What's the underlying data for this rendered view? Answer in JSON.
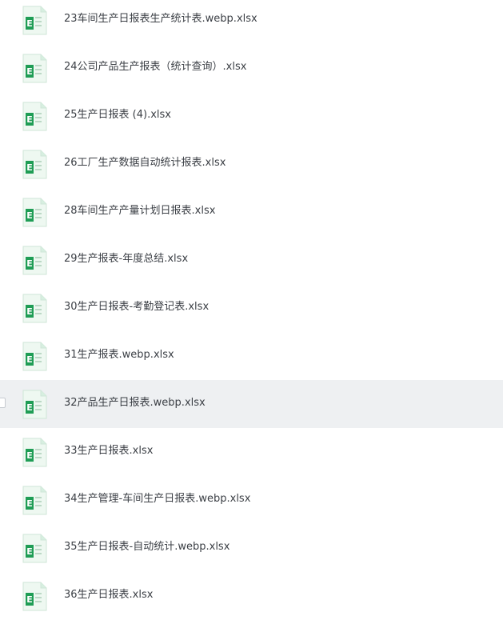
{
  "files": [
    {
      "name": "23车间生产日报表生产统计表.webp.xlsx",
      "icon": "excel-file-icon"
    },
    {
      "name": "24公司产品生产报表（统计查询）.xlsx",
      "icon": "excel-file-icon"
    },
    {
      "name": "25生产日报表 (4).xlsx",
      "icon": "excel-file-icon"
    },
    {
      "name": "26工厂生产数据自动统计报表.xlsx",
      "icon": "excel-file-icon"
    },
    {
      "name": "28车间生产产量计划日报表.xlsx",
      "icon": "excel-file-icon"
    },
    {
      "name": "29生产报表-年度总结.xlsx",
      "icon": "excel-file-icon"
    },
    {
      "name": "30生产日报表-考勤登记表.xlsx",
      "icon": "excel-file-icon"
    },
    {
      "name": "31生产报表.webp.xlsx",
      "icon": "excel-file-icon"
    },
    {
      "name": "32产品生产日报表.webp.xlsx",
      "icon": "excel-file-icon"
    },
    {
      "name": "33生产日报表.xlsx",
      "icon": "excel-file-icon"
    },
    {
      "name": "34生产管理-车间生产日报表.webp.xlsx",
      "icon": "excel-file-icon"
    },
    {
      "name": "35生产日报表-自动统计.webp.xlsx",
      "icon": "excel-file-icon"
    },
    {
      "name": "36生产日报表.xlsx",
      "icon": "excel-file-icon"
    }
  ],
  "hovered_index": 8,
  "colors": {
    "icon_green": "#1f9d55",
    "icon_sheet": "#eef8f1",
    "hover_bg": "#eef0f2",
    "text": "#3b3f45"
  }
}
